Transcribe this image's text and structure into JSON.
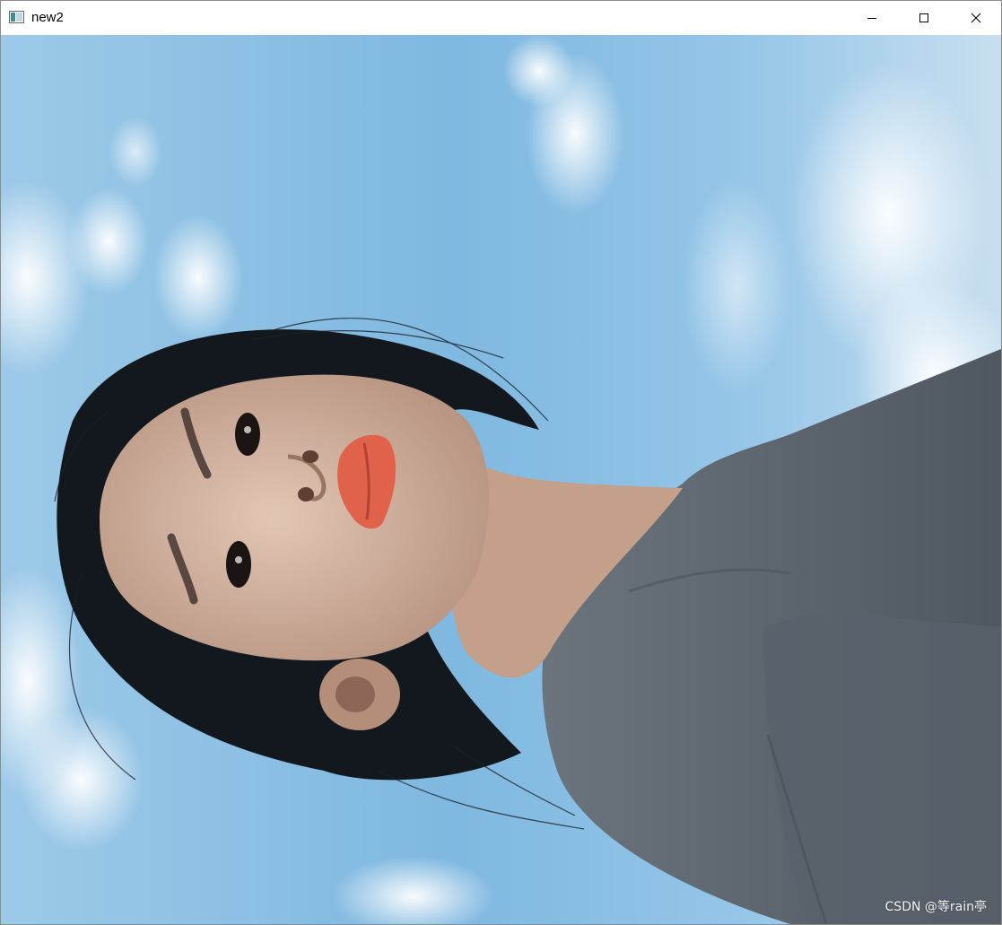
{
  "window": {
    "title": "new2",
    "icon": "window-app-icon"
  },
  "caption_buttons": {
    "minimize_icon": "minimize-icon",
    "maximize_icon": "maximize-icon",
    "close_icon": "close-icon"
  },
  "image": {
    "watermark": "CSDN @等rain亭"
  },
  "colors": {
    "sky": "#8ec2e6",
    "shirt": "#5c6670",
    "hair": "#11161c",
    "skin": "#d6b8a4",
    "lips": "#e0624a"
  }
}
